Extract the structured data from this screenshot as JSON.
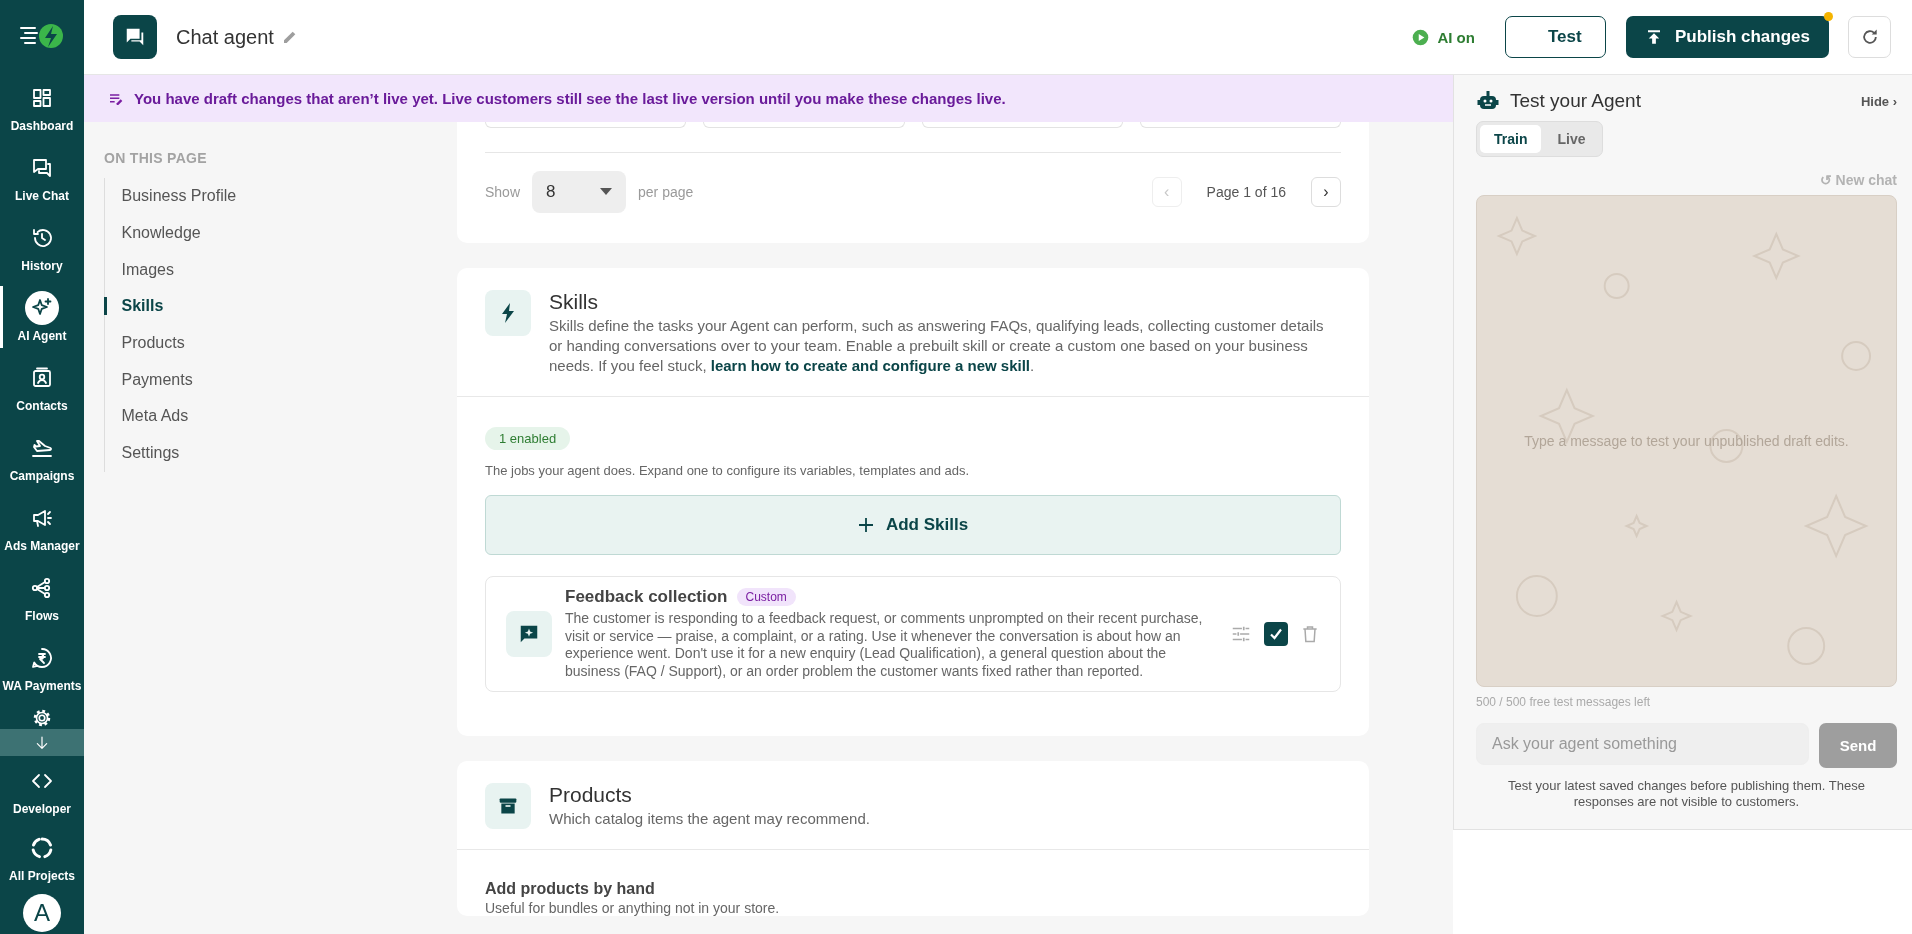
{
  "app_nav": {
    "items": [
      {
        "label": "Dashboard",
        "selected": false
      },
      {
        "label": "Live Chat",
        "selected": false
      },
      {
        "label": "History",
        "selected": false
      },
      {
        "label": "AI Agent",
        "selected": true
      },
      {
        "label": "Contacts",
        "selected": false
      },
      {
        "label": "Campaigns",
        "selected": false
      },
      {
        "label": "Ads Manager",
        "selected": false
      },
      {
        "label": "Flows",
        "selected": false
      },
      {
        "label": "WA Payments",
        "selected": false
      }
    ],
    "bottom_items": [
      {
        "label": "Developer",
        "selected": false
      },
      {
        "label": "All Projects",
        "selected": false
      }
    ],
    "avatar": "A"
  },
  "header": {
    "title": "Chat agent",
    "ai_status": "AI on",
    "test_button": "Test",
    "publish_button": "Publish changes",
    "unpublished": true
  },
  "banner": {
    "text": "You have draft changes that aren’t live yet. Live customers still see the last live version until you make these changes live."
  },
  "page_nav": {
    "heading": "ON THIS PAGE",
    "items": [
      {
        "label": "Business Profile",
        "selected": false
      },
      {
        "label": "Knowledge",
        "selected": false
      },
      {
        "label": "Images",
        "selected": false
      },
      {
        "label": "Skills",
        "selected": true
      },
      {
        "label": "Products",
        "selected": false
      },
      {
        "label": "Payments",
        "selected": false
      },
      {
        "label": "Meta Ads",
        "selected": false
      },
      {
        "label": "Settings",
        "selected": false
      }
    ]
  },
  "pagination": {
    "show_label": "Show",
    "per_page_value": "8",
    "per_page_label": "per page",
    "page_label": "Page 1 of 16",
    "prev": {
      "symbol": "‹",
      "disabled": true
    },
    "next": {
      "symbol": "›",
      "disabled": false
    }
  },
  "skills": {
    "title": "Skills",
    "description": "Skills define the tasks your Agent can perform, such as answering FAQs, qualifying leads, collecting customer details or handing conversations over to your team. Enable a prebuilt skill or create a custom one based on your business needs. If you feel stuck, ",
    "link": "learn how to create and configure a new skill",
    "description_end": ".",
    "enabled_badge": "1 enabled",
    "hint": "The jobs your agent does. Expand one to configure its variables, templates and ads.",
    "add_button": "Add Skills",
    "items": [
      {
        "title": "Feedback collection",
        "tag": "Custom",
        "description": "The customer is responding to a feedback request, or comments unprompted on their recent purchase, visit or service — praise, a complaint, or a rating. Use it whenever the conversation is about how an experience went. Don't use it for a new enquiry (Lead Qualification), a general question about the business (FAQ / Support), or an order problem the customer wants fixed rather than reported.",
        "enabled": true
      }
    ]
  },
  "products": {
    "title": "Products",
    "subtitle": "Which catalog items the agent may recommend.",
    "manual_title": "Add products by hand",
    "manual_subtitle": "Useful for bundles or anything not in your store."
  },
  "test_panel": {
    "title": "Test your Agent",
    "hide": "Hide ›",
    "modes": [
      {
        "label": "Train",
        "selected": true
      },
      {
        "label": "Live",
        "selected": false
      }
    ],
    "new_chat": "↺ New chat",
    "empty_hint": "Type a message to test your unpublished draft edits.",
    "quota": "500 / 500 free test messages left",
    "input_placeholder": "Ask your agent something",
    "send_button": "Send",
    "send_disabled": true,
    "note": "Test your latest saved changes before publishing them. These responses are not visible to customers."
  }
}
